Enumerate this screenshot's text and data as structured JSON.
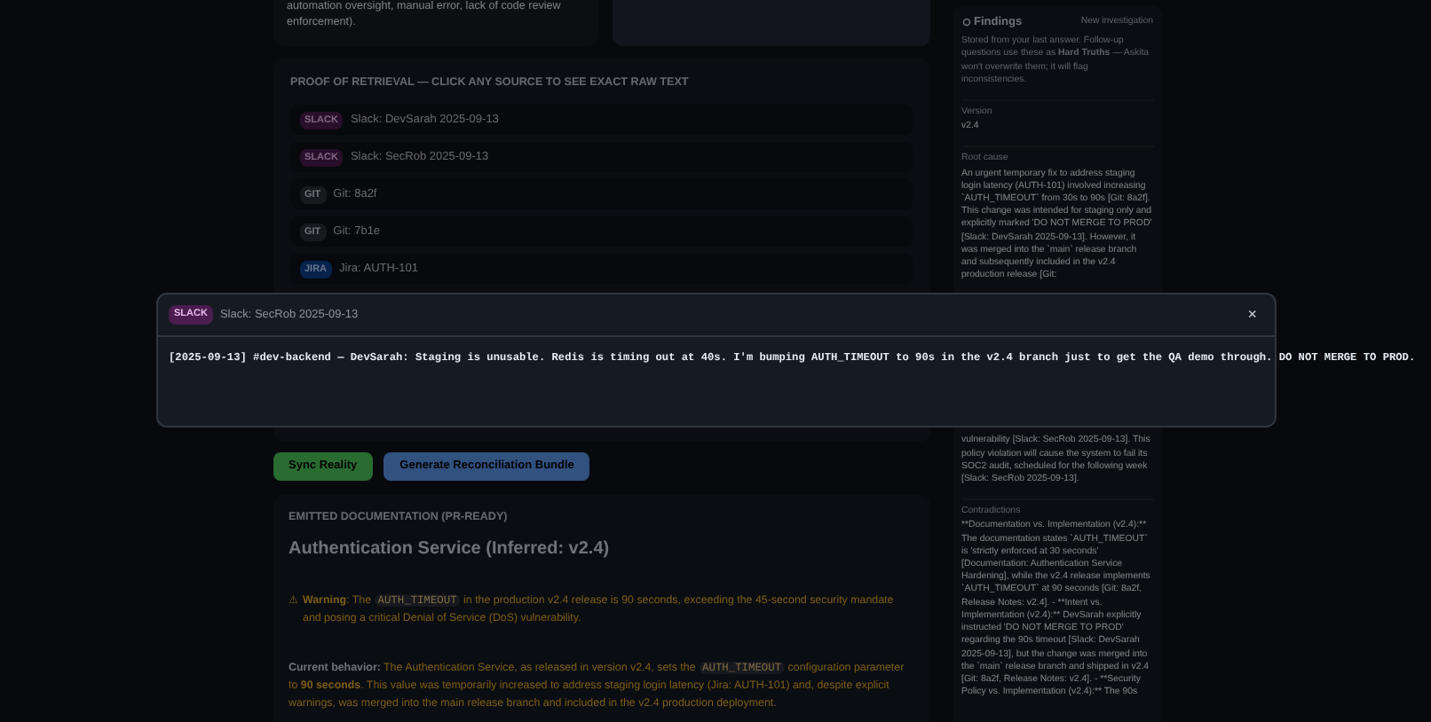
{
  "summary_card": {
    "text": "automation oversight, manual error, lack of code review enforcement)."
  },
  "retrieval": {
    "heading": "PROOF OF RETRIEVAL — CLICK ANY SOURCE TO SEE EXACT RAW TEXT",
    "sources": [
      {
        "kind": "slack",
        "badge": "SLACK",
        "label": "Slack: DevSarah 2025-09-13"
      },
      {
        "kind": "slack",
        "badge": "SLACK",
        "label": "Slack: SecRob 2025-09-13"
      },
      {
        "kind": "git",
        "badge": "GIT",
        "label": "Git: 8a2f"
      },
      {
        "kind": "git",
        "badge": "GIT",
        "label": "Git: 7b1e"
      },
      {
        "kind": "jira",
        "badge": "JIRA",
        "label": "Jira: AUTH-101"
      }
    ]
  },
  "actions": [
    {
      "kind": "green",
      "label": "Sync Reality"
    },
    {
      "kind": "blue",
      "label": "Generate Reconciliation Bundle"
    }
  ],
  "documentation": {
    "heading": "EMITTED DOCUMENTATION (PR-READY)",
    "title": "Authentication Service (Inferred: v2.4)",
    "warning": {
      "icon": "⚠",
      "segments": [
        {
          "kind": "bold",
          "text": "Warning"
        },
        {
          "kind": "text",
          "text": ": The "
        },
        {
          "kind": "code",
          "text": "AUTH_TIMEOUT"
        },
        {
          "kind": "text",
          "text": " in the production v2.4 release is 90 seconds, exceeding the 45-second security mandate and posing a critical Denial of Service (DoS) vulnerability."
        }
      ]
    },
    "behavior": {
      "segments": [
        {
          "kind": "lead",
          "text": "Current behavior:"
        },
        {
          "kind": "text",
          "text": " The Authentication Service, as released in version v2.4, sets the "
        },
        {
          "kind": "code",
          "text": "AUTH_TIMEOUT"
        },
        {
          "kind": "text",
          "text": " configuration parameter to "
        },
        {
          "kind": "bold",
          "text": "90 seconds"
        },
        {
          "kind": "text",
          "text": ". This value was temporarily increased to address staging login latency (Jira: AUTH-101) and, despite explicit warnings, was merged into the main release branch and included in the v2.4 production deployment."
        }
      ]
    }
  },
  "findings": {
    "title": "Findings",
    "action": "New investigation",
    "intro": "Stored from your last answer. Follow-up questions use these as **Hard Truths** — Askita won't overwrite them; it will flag inconsistencies.",
    "fields": [
      {
        "label": "Version",
        "parts": [
          "v2.4"
        ]
      },
      {
        "label": "Root cause",
        "parts": [
          "An urgent temporary fix to address staging login latency (AUTH-101) involved increasing `AUTH_TIMEOUT` from 30s to 90s [Git: 8a2f]. This change was intended for staging only and explicitly marked 'DO NOT MERGE TO PROD' [Slack: DevSarah 2025-09-13]. However, it was merged into the `main` release branch and subsequently included in the v2.4 production release [Git:",
          "vulnerability [Slack: SecRob 2025-09-13]. This policy violation will cause the system to fail its SOC2 audit, scheduled for the following week [Slack: SecRob 2025-09-13]."
        ]
      },
      {
        "label": "Contradictions",
        "parts": [
          "**Documentation vs. Implementation (v2.4):** The documentation states `AUTH_TIMEOUT` is 'strictly enforced at 30 seconds' [Documentation: Authentication Service Hardening], while the v2.4 release implements `AUTH_TIMEOUT` at 90 seconds [Git: 8a2f, Release Notes: v2.4]. - **Intent vs. Implementation (v2.4):** DevSarah explicitly instructed 'DO NOT MERGE TO PROD' regarding the 90s timeout [Slack: DevSarah 2025-09-13], but the change was merged into the `main` release branch and shipped in v2.4 [Git: 8a2f, Release Notes: v2.4]. - **Security Policy vs. Implementation (v2.4):** The 90s"
        ]
      }
    ]
  },
  "modal": {
    "kind": "slack",
    "badge": "SLACK",
    "title": "Slack: SecRob 2025-09-13",
    "close": "×",
    "body": "[2025-09-13] #dev-backend — DevSarah: Staging is unusable. Redis is timing out at 40s. I'm bumping AUTH_TIMEOUT to 90s in the v2.4 branch just to get the QA demo through. DO NOT MERGE TO PROD."
  }
}
